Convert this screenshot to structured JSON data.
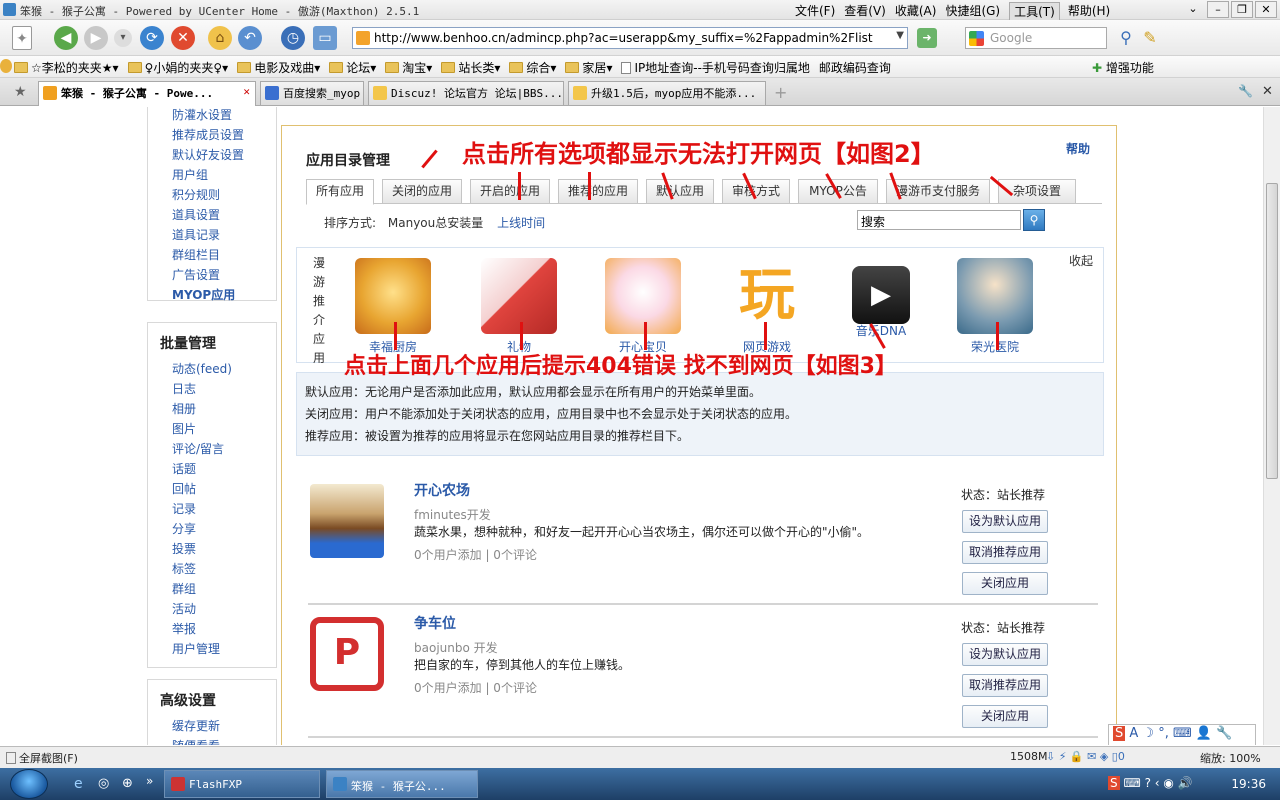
{
  "window": {
    "title": "笨猴 - 猴子公寓 - Powered by UCenter Home - 傲游(Maxthon) 2.5.1",
    "menus": [
      "文件(F)",
      "查看(V)",
      "收藏(A)",
      "快捷组(G)",
      "工具(T)",
      "帮助(H)"
    ],
    "active_menu": "工具(T)"
  },
  "address": {
    "url": "http://www.benhoo.cn/admincp.php?ac=userapp&my_suffix=%2Fappadmin%2Flist",
    "search_placeholder": "Google"
  },
  "favorites": {
    "items": [
      "☆李松的夹夹★",
      "♀小娟的夹夹♀",
      "电影及戏曲",
      "论坛",
      "淘宝",
      "站长类",
      "综合",
      "家居",
      "IP地址查询--手机号码查询归属地",
      "邮政编码查询"
    ],
    "right_label": "增强功能"
  },
  "tabs": [
    {
      "label": "笨猴 - 猴子公寓 - Powe...",
      "active": true
    },
    {
      "label": "百度搜索_myop",
      "active": false
    },
    {
      "label": "Discuz! 论坛官方 论坛|BBS...",
      "active": false
    },
    {
      "label": "升级1.5后，myop应用不能添...",
      "active": false
    }
  ],
  "sidebar": {
    "top_items": [
      "防灌水设置",
      "推荐成员设置",
      "默认好友设置",
      "用户组",
      "积分规则",
      "道具设置",
      "道具记录",
      "群组栏目",
      "广告设置",
      "MYOP应用"
    ],
    "batch_title": "批量管理",
    "batch_items": [
      "动态(feed)",
      "日志",
      "相册",
      "图片",
      "评论/留言",
      "话题",
      "回帖",
      "记录",
      "分享",
      "投票",
      "标签",
      "群组",
      "活动",
      "举报",
      "用户管理"
    ],
    "advanced_title": "高级设置",
    "advanced_items": [
      "缓存更新",
      "随便看看"
    ]
  },
  "panel": {
    "title": "应用目录管理",
    "help": "帮助",
    "tabs": [
      "所有应用",
      "关闭的应用",
      "开启的应用",
      "推荐的应用",
      "默认应用",
      "审核方式",
      "MYOP公告",
      "漫游币支付服务",
      "杂项设置"
    ],
    "sort_label": "排序方式:",
    "sort_options": [
      "Manyou总安装量",
      "上线时间"
    ],
    "search_value": "搜索",
    "rec_label": [
      "漫",
      "游",
      "推",
      "介",
      "应",
      "用"
    ],
    "collapse": "收起",
    "rec_apps": [
      {
        "name": "幸福厨房",
        "color": "#e8a531"
      },
      {
        "name": "礼物",
        "color": "#e0443e"
      },
      {
        "name": "开心宝贝",
        "color": "#f3b5c9"
      },
      {
        "name": "网页游戏",
        "color": "#f4a623"
      },
      {
        "name": "音乐DNA",
        "color": "#222222"
      },
      {
        "name": "荣光医院",
        "color": "#3a6a8a"
      }
    ],
    "notes": [
      "默认应用：无论用户是否添加此应用，默认应用都会显示在所有用户的开始菜单里面。",
      "关闭应用：用户不能添加处于关闭状态的应用，应用目录中也不会显示处于关闭状态的应用。",
      "推荐应用：被设置为推荐的应用将显示在您网站应用目录的推荐栏目下。"
    ],
    "apps": [
      {
        "name": "开心农场",
        "developer": "fminutes开发",
        "description": "蔬菜水果，想种就种，和好友一起开开心心当农场主，偶尔还可以做个开心的\"小偷\"。",
        "meta": "0个用户添加 | 0个评论",
        "state": "状态：站长推荐",
        "buttons": [
          "设为默认应用",
          "取消推荐应用",
          "关闭应用"
        ]
      },
      {
        "name": "争车位",
        "developer": "baojunbo 开发",
        "description": "把自家的车，停到其他人的车位上赚钱。",
        "meta": "0个用户添加 | 0个评论",
        "state": "状态：站长推荐",
        "buttons": [
          "设为默认应用",
          "取消推荐应用",
          "关闭应用"
        ]
      }
    ]
  },
  "annotations": {
    "top": "点击所有选项都显示无法打开网页【如图2】",
    "middle": "点击上面几个应用后提示404错误  找不到网页【如图3】"
  },
  "status": {
    "left": "全屏截图(F)",
    "memory": "1508M",
    "zoom": "缩放: 100%"
  },
  "taskbar": {
    "items": [
      "FlashFXP",
      "笨猴 - 猴子公..."
    ],
    "time": "19:36"
  },
  "colors": {
    "link": "#2b5aa8",
    "annotation": "#e01010",
    "panel_border": "#e0c070"
  }
}
